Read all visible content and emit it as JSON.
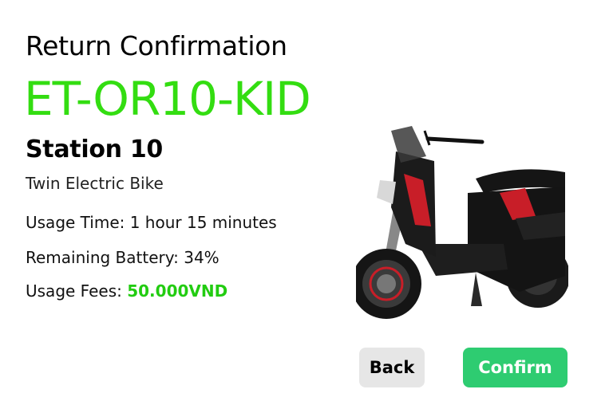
{
  "header": {
    "title": "Return Confirmation"
  },
  "vehicle": {
    "code": "ET-OR10-KID",
    "station": "Station 10",
    "type": "Twin Electric Bike"
  },
  "details": {
    "usage_time": "Usage Time: 1 hour 15 minutes",
    "remaining_battery": "Remaining Battery: 34%",
    "usage_fees_label": "Usage Fees: ",
    "usage_fees_value": "50.000VND"
  },
  "image": {
    "icon": "electric-scooter-image"
  },
  "actions": {
    "back_label": "Back",
    "confirm_label": "Confirm"
  },
  "colors": {
    "code_green": "#33dd11",
    "fee_green": "#22cc11",
    "confirm_bg": "#2ecc71",
    "back_bg": "#e6e6e6"
  }
}
